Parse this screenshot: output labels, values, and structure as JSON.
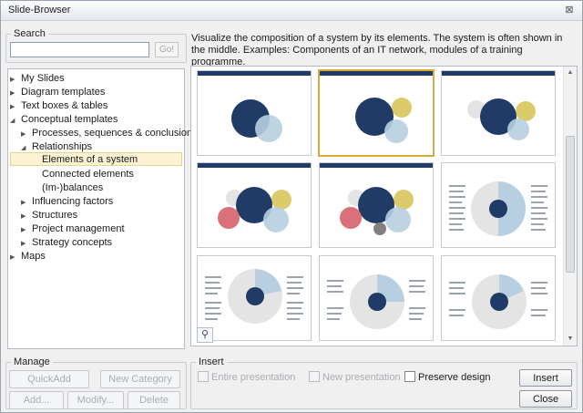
{
  "window": {
    "title": "Slide-Browser",
    "close_glyph": "⊠"
  },
  "search": {
    "legend": "Search",
    "value": "",
    "go_label": "Go!"
  },
  "tree": {
    "items": [
      {
        "label": "My Slides",
        "arrow": "▶"
      },
      {
        "label": "Diagram templates",
        "arrow": "▶"
      },
      {
        "label": "Text boxes & tables",
        "arrow": "▶"
      },
      {
        "label": "Conceptual templates",
        "arrow": "◢"
      },
      {
        "label": "Processes, sequences & conclusions",
        "arrow": "▶"
      },
      {
        "label": "Relationships",
        "arrow": "◢"
      },
      {
        "label": "Elements of a system",
        "arrow": ""
      },
      {
        "label": "Connected elements",
        "arrow": ""
      },
      {
        "label": "(Im-)balances",
        "arrow": ""
      },
      {
        "label": "Influencing factors",
        "arrow": "▶"
      },
      {
        "label": "Structures",
        "arrow": "▶"
      },
      {
        "label": "Project management",
        "arrow": "▶"
      },
      {
        "label": "Strategy concepts",
        "arrow": "▶"
      },
      {
        "label": "Maps",
        "arrow": "▶"
      }
    ]
  },
  "description": "Visualize the composition of a system by its elements. The system is often shown in the middle. Examples: Components of an IT network, modules of a training programme.",
  "gallery": {
    "zoom_icon": "⚲",
    "scroll_up": "▲",
    "scroll_down": "▼"
  },
  "manage": {
    "legend": "Manage",
    "quickadd": "QuickAdd",
    "new_category": "New Category",
    "add": "Add...",
    "modify": "Modify...",
    "delete": "Delete"
  },
  "insert": {
    "legend": "Insert",
    "entire_presentation": "Entire presentation",
    "new_presentation": "New presentation",
    "preserve_design": "Preserve design",
    "insert_button": "Insert",
    "close_button": "Close"
  },
  "colors": {
    "navy": "#1f3b66",
    "light_blue": "#b7cfe0",
    "yellow": "#dccb6a",
    "gray": "#e4e4e4",
    "red": "#d9707a",
    "selection": "#d9a93a"
  }
}
